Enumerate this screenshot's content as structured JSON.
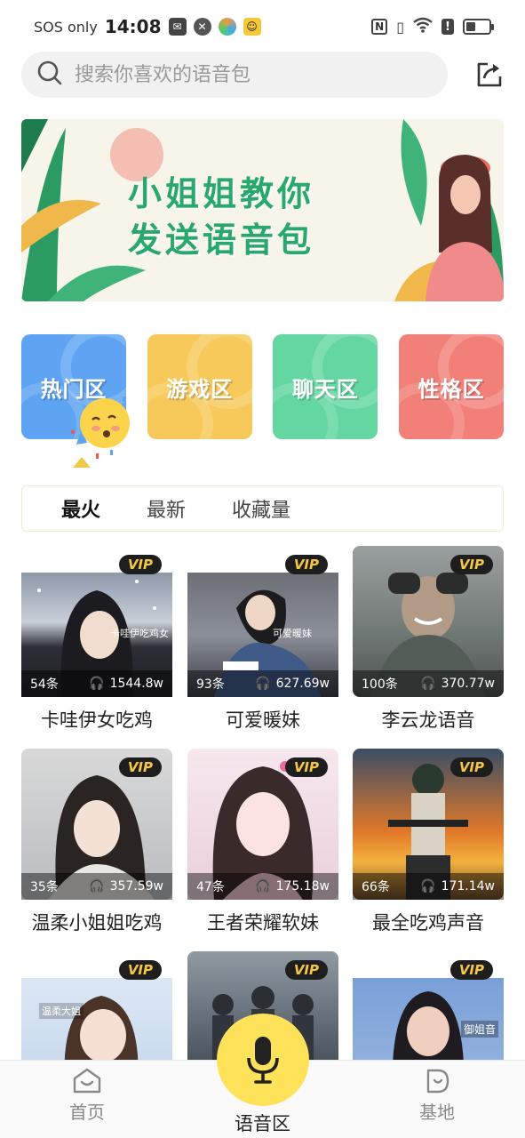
{
  "status_bar": {
    "carrier": "SOS only",
    "time": "14:08"
  },
  "search": {
    "placeholder": "搜索你喜欢的语音包"
  },
  "banner": {
    "line1": "小姐姐教你",
    "line2": "发送语音包"
  },
  "categories": [
    {
      "label": "热门区",
      "color": "#5ea4f3"
    },
    {
      "label": "游戏区",
      "color": "#f7c95a"
    },
    {
      "label": "聊天区",
      "color": "#63d6a2"
    },
    {
      "label": "性格区",
      "color": "#f28079"
    }
  ],
  "tabs": [
    {
      "label": "最火",
      "active": true
    },
    {
      "label": "最新",
      "active": false
    },
    {
      "label": "收藏量",
      "active": false
    }
  ],
  "packs": [
    {
      "name": "卡哇伊女吃鸡",
      "count": "54条",
      "plays": "1544.8w",
      "vip": "VIP",
      "overlay": "卡哇伊吃鸡女"
    },
    {
      "name": "可爱暖妹",
      "count": "93条",
      "plays": "627.69w",
      "vip": "VIP",
      "overlay": "可爱暖妹"
    },
    {
      "name": "李云龙语音",
      "count": "100条",
      "plays": "370.77w",
      "vip": "VIP",
      "overlay": ""
    },
    {
      "name": "温柔小姐姐吃鸡",
      "count": "35条",
      "plays": "357.59w",
      "vip": "VIP",
      "overlay": ""
    },
    {
      "name": "王者荣耀软妹",
      "count": "47条",
      "plays": "175.18w",
      "vip": "VIP",
      "overlay": ""
    },
    {
      "name": "最全吃鸡声音",
      "count": "66条",
      "plays": "171.14w",
      "vip": "VIP",
      "overlay": ""
    },
    {
      "name": "",
      "count": "",
      "plays": "",
      "vip": "VIP",
      "overlay": "温柔大姐"
    },
    {
      "name": "",
      "count": "",
      "plays": "",
      "vip": "VIP",
      "overlay": ""
    },
    {
      "name": "",
      "count": "",
      "plays": "",
      "vip": "VIP",
      "overlay": "御姐音"
    }
  ],
  "bottom_nav": {
    "home": "首页",
    "voice": "语音区",
    "base": "基地"
  },
  "colors": {
    "accent_yellow": "#fde25a",
    "vip_gold": "#f6c745",
    "banner_green": "#29a86c"
  }
}
